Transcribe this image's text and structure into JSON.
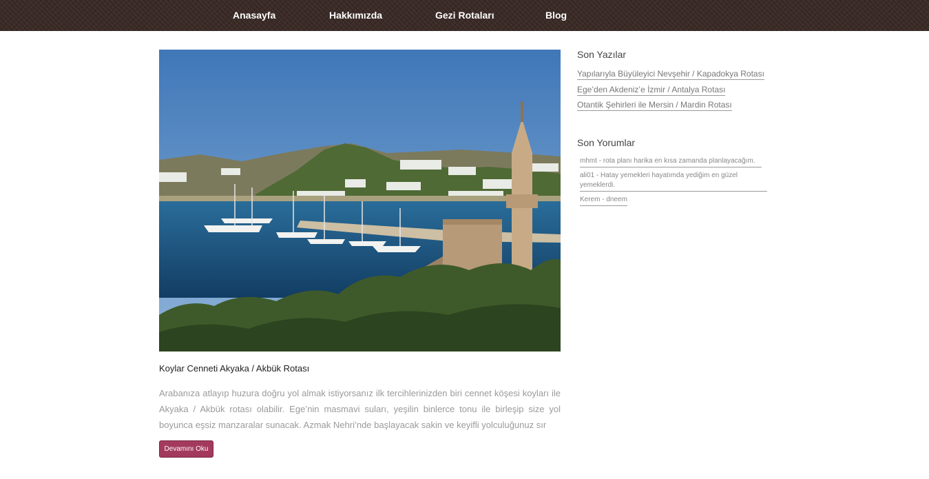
{
  "nav": {
    "items": [
      {
        "label": "Anasayfa"
      },
      {
        "label": "Hakkımızda"
      },
      {
        "label": "Gezi Rotaları"
      },
      {
        "label": "Blog"
      }
    ]
  },
  "post": {
    "title": "Koylar Cenneti Akyaka / Akbük Rotası",
    "excerpt": "Arabanıza atlayıp huzura doğru yol almak istiyorsanız ilk tercihlerinizden biri cennet köşesi koyları ile Akyaka / Akbük rotası olabilir. Ege’nin masmavi suları, yeşilin binlerce tonu ile birleşip size yol boyunca eşsiz manzaralar sunacak. Azmak Nehri’nde başlayacak sakin ve keyifli yolculuğunuz sır",
    "read_more_label": "Devamını Oku"
  },
  "sidebar": {
    "recent_posts_title": "Son Yazılar",
    "recent_posts": [
      {
        "label": "Yapılarıyla Büyüleyici Nevşehir / Kapadokya Rotası"
      },
      {
        "label": "Ege’den Akdeniz’e İzmir / Antalya Rotası"
      },
      {
        "label": "Otantik Şehirleri ile Mersin / Mardin Rotası"
      }
    ],
    "recent_comments_title": "Son Yorumlar",
    "recent_comments": [
      {
        "text": "mhmt - rota planı harika en kısa zamanda planlayacağım."
      },
      {
        "text": "ali01 - Hatay yemekleri hayatımda yediğim en güzel yemeklerdi."
      },
      {
        "text": "Kerem - dneem"
      }
    ]
  },
  "colors": {
    "header_bg": "#3a2a26",
    "button_bg": "#a33a5e"
  }
}
